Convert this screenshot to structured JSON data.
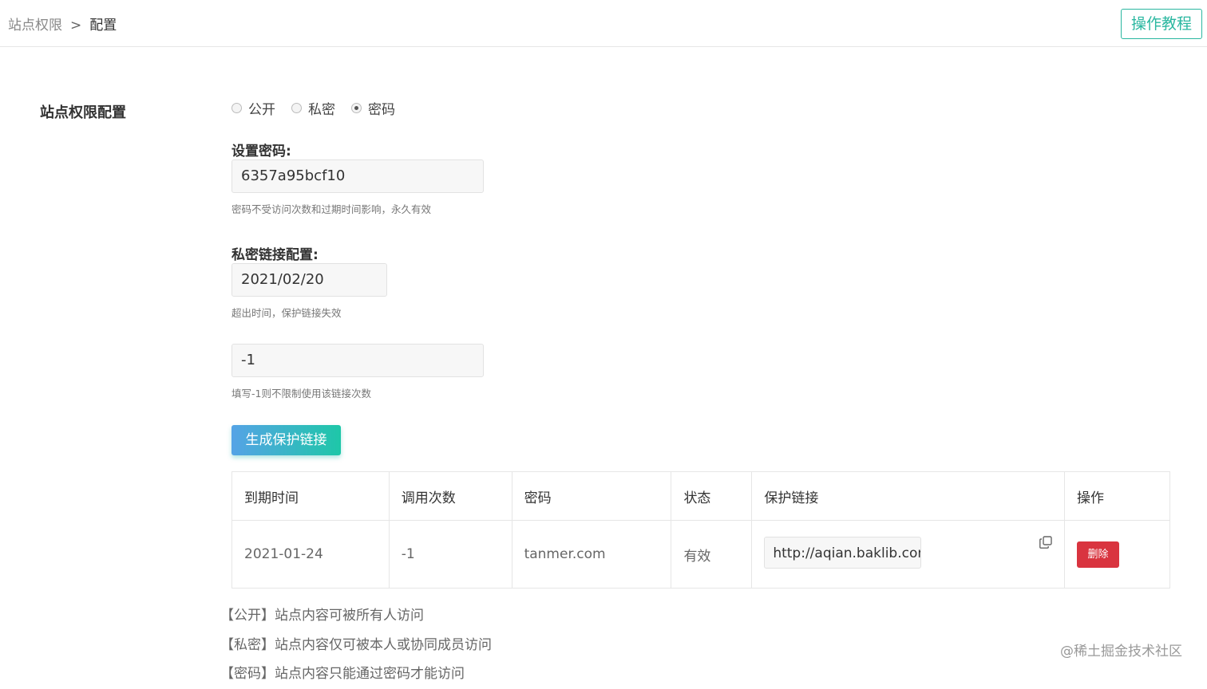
{
  "breadcrumb": {
    "parent": "站点权限",
    "separator": ">",
    "current": "配置"
  },
  "header": {
    "tutorial_button": "操作教程"
  },
  "section_title": "站点权限配置",
  "access_options": [
    {
      "label": "公开",
      "checked": false
    },
    {
      "label": "私密",
      "checked": false
    },
    {
      "label": "密码",
      "checked": true
    }
  ],
  "password": {
    "label": "设置密码:",
    "value": "6357a95bcf10",
    "hint": "密码不受访问次数和过期时间影响，永久有效"
  },
  "private_link": {
    "label": "私密链接配置:",
    "expire_value": "2021/02/20",
    "expire_hint": "超出时间，保护链接失效",
    "count_value": "-1",
    "count_hint": "填写-1则不限制使用该链接次数",
    "generate_button": "生成保护链接"
  },
  "table": {
    "headers": [
      "到期时间",
      "调用次数",
      "密码",
      "状态",
      "保护链接",
      "操作"
    ],
    "rows": [
      {
        "expire": "2021-01-24",
        "count": "-1",
        "password": "tanmer.com",
        "status": "有效",
        "link": "http://aqian.baklib.com",
        "action": "删除"
      }
    ]
  },
  "notes": [
    "【公开】站点内容可被所有人访问",
    "【私密】站点内容仅可被本人或协同成员访问",
    "【密码】站点内容只能通过密码才能访问"
  ],
  "watermark": "@稀土掘金技术社区"
}
